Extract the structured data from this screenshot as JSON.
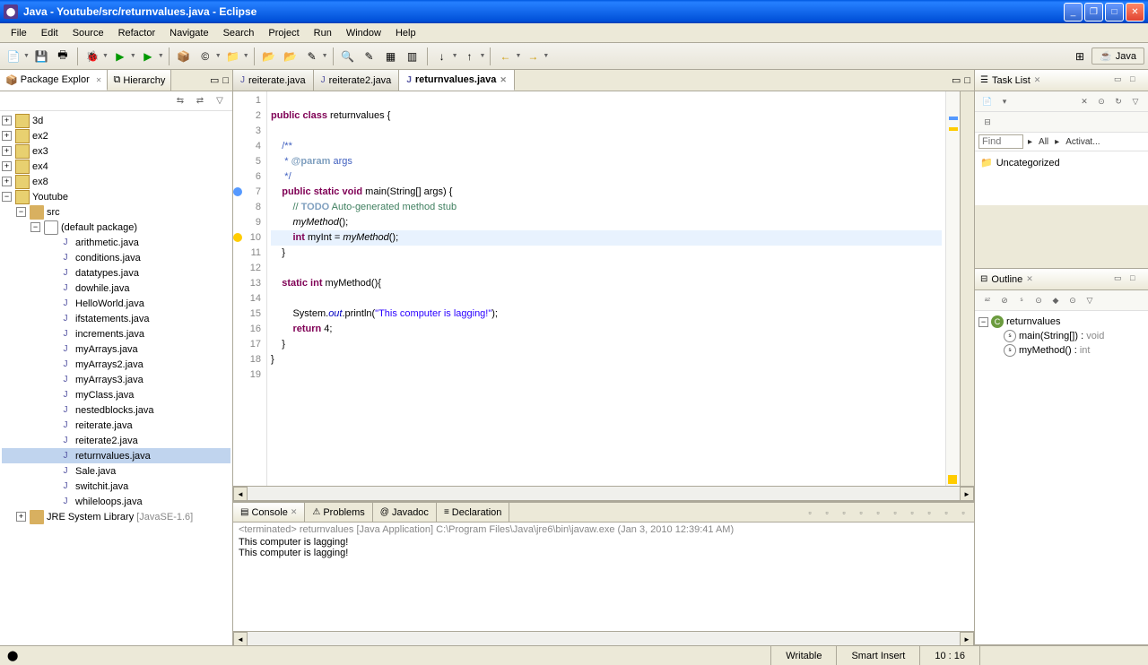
{
  "window": {
    "title": "Java - Youtube/src/returnvalues.java - Eclipse"
  },
  "menubar": [
    "File",
    "Edit",
    "Source",
    "Refactor",
    "Navigate",
    "Search",
    "Project",
    "Run",
    "Window",
    "Help"
  ],
  "perspective": "Java",
  "left_panel": {
    "tabs": [
      {
        "label": "Package Explor",
        "active": true
      },
      {
        "label": "Hierarchy",
        "active": false
      }
    ],
    "projects": [
      "3d",
      "ex2",
      "ex3",
      "ex4",
      "ex8"
    ],
    "open_project": "Youtube",
    "src_label": "src",
    "pkg_label": "(default package)",
    "files": [
      "arithmetic.java",
      "conditions.java",
      "datatypes.java",
      "dowhile.java",
      "HelloWorld.java",
      "ifstatements.java",
      "increments.java",
      "myArrays.java",
      "myArrays2.java",
      "myArrays3.java",
      "myClass.java",
      "nestedblocks.java",
      "reiterate.java",
      "reiterate2.java",
      "returnvalues.java",
      "Sale.java",
      "switchit.java",
      "whileloops.java"
    ],
    "selected_file": "returnvalues.java",
    "jre_label": "JRE System Library",
    "jre_version": "[JavaSE-1.6]"
  },
  "editor": {
    "tabs": [
      {
        "label": "reiterate.java",
        "active": false
      },
      {
        "label": "reiterate2.java",
        "active": false
      },
      {
        "label": "returnvalues.java",
        "active": true
      }
    ],
    "lines": [
      {
        "n": 1,
        "html": ""
      },
      {
        "n": 2,
        "html": "<span class='kw'>public</span> <span class='kw'>class</span> returnvalues {"
      },
      {
        "n": 3,
        "html": ""
      },
      {
        "n": 4,
        "html": "    <span class='jdoc'>/**</span>"
      },
      {
        "n": 5,
        "html": "    <span class='jdoc'> * <span class='jdoc-tag'>@param</span> args</span>"
      },
      {
        "n": 6,
        "html": "    <span class='jdoc'> */</span>"
      },
      {
        "n": 7,
        "html": "    <span class='kw'>public</span> <span class='kw'>static</span> <span class='kw'>void</span> main(String[] args) {",
        "marker": "info"
      },
      {
        "n": 8,
        "html": "        <span class='com'>// <span class='task'>TODO</span> Auto-generated method stub</span>"
      },
      {
        "n": 9,
        "html": "        <span class='method-call'>myMethod</span>();"
      },
      {
        "n": 10,
        "html": "        <span class='kw'>int</span> myInt = <span class='method-call'>myMethod</span>();",
        "current": true,
        "marker": "warn"
      },
      {
        "n": 11,
        "html": "    }"
      },
      {
        "n": 12,
        "html": ""
      },
      {
        "n": 13,
        "html": "    <span class='kw'>static</span> <span class='kw'>int</span> myMethod(){"
      },
      {
        "n": 14,
        "html": ""
      },
      {
        "n": 15,
        "html": "        System.<span class='field'>out</span>.println(<span class='str'>\"This computer is lagging!\"</span>);"
      },
      {
        "n": 16,
        "html": "        <span class='kw'>return</span> 4;"
      },
      {
        "n": 17,
        "html": "    }"
      },
      {
        "n": 18,
        "html": "}"
      },
      {
        "n": 19,
        "html": ""
      }
    ]
  },
  "console": {
    "tabs": [
      {
        "label": "Console",
        "active": true
      },
      {
        "label": "Problems",
        "active": false
      },
      {
        "label": "Javadoc",
        "active": false
      },
      {
        "label": "Declaration",
        "active": false
      }
    ],
    "header": "<terminated> returnvalues [Java Application] C:\\Program Files\\Java\\jre6\\bin\\javaw.exe (Jan 3, 2010 12:39:41 AM)",
    "output": [
      "This computer is lagging!",
      "This computer is lagging!"
    ]
  },
  "task_list": {
    "title": "Task List",
    "find_placeholder": "Find",
    "all": "All",
    "activate": "Activat...",
    "uncategorized": "Uncategorized"
  },
  "outline": {
    "title": "Outline",
    "class_name": "returnvalues",
    "methods": [
      {
        "name": "main(String[])",
        "ret": "void",
        "static": true
      },
      {
        "name": "myMethod()",
        "ret": "int",
        "static": true
      }
    ]
  },
  "status": {
    "writable": "Writable",
    "insert": "Smart Insert",
    "pos": "10 : 16"
  }
}
